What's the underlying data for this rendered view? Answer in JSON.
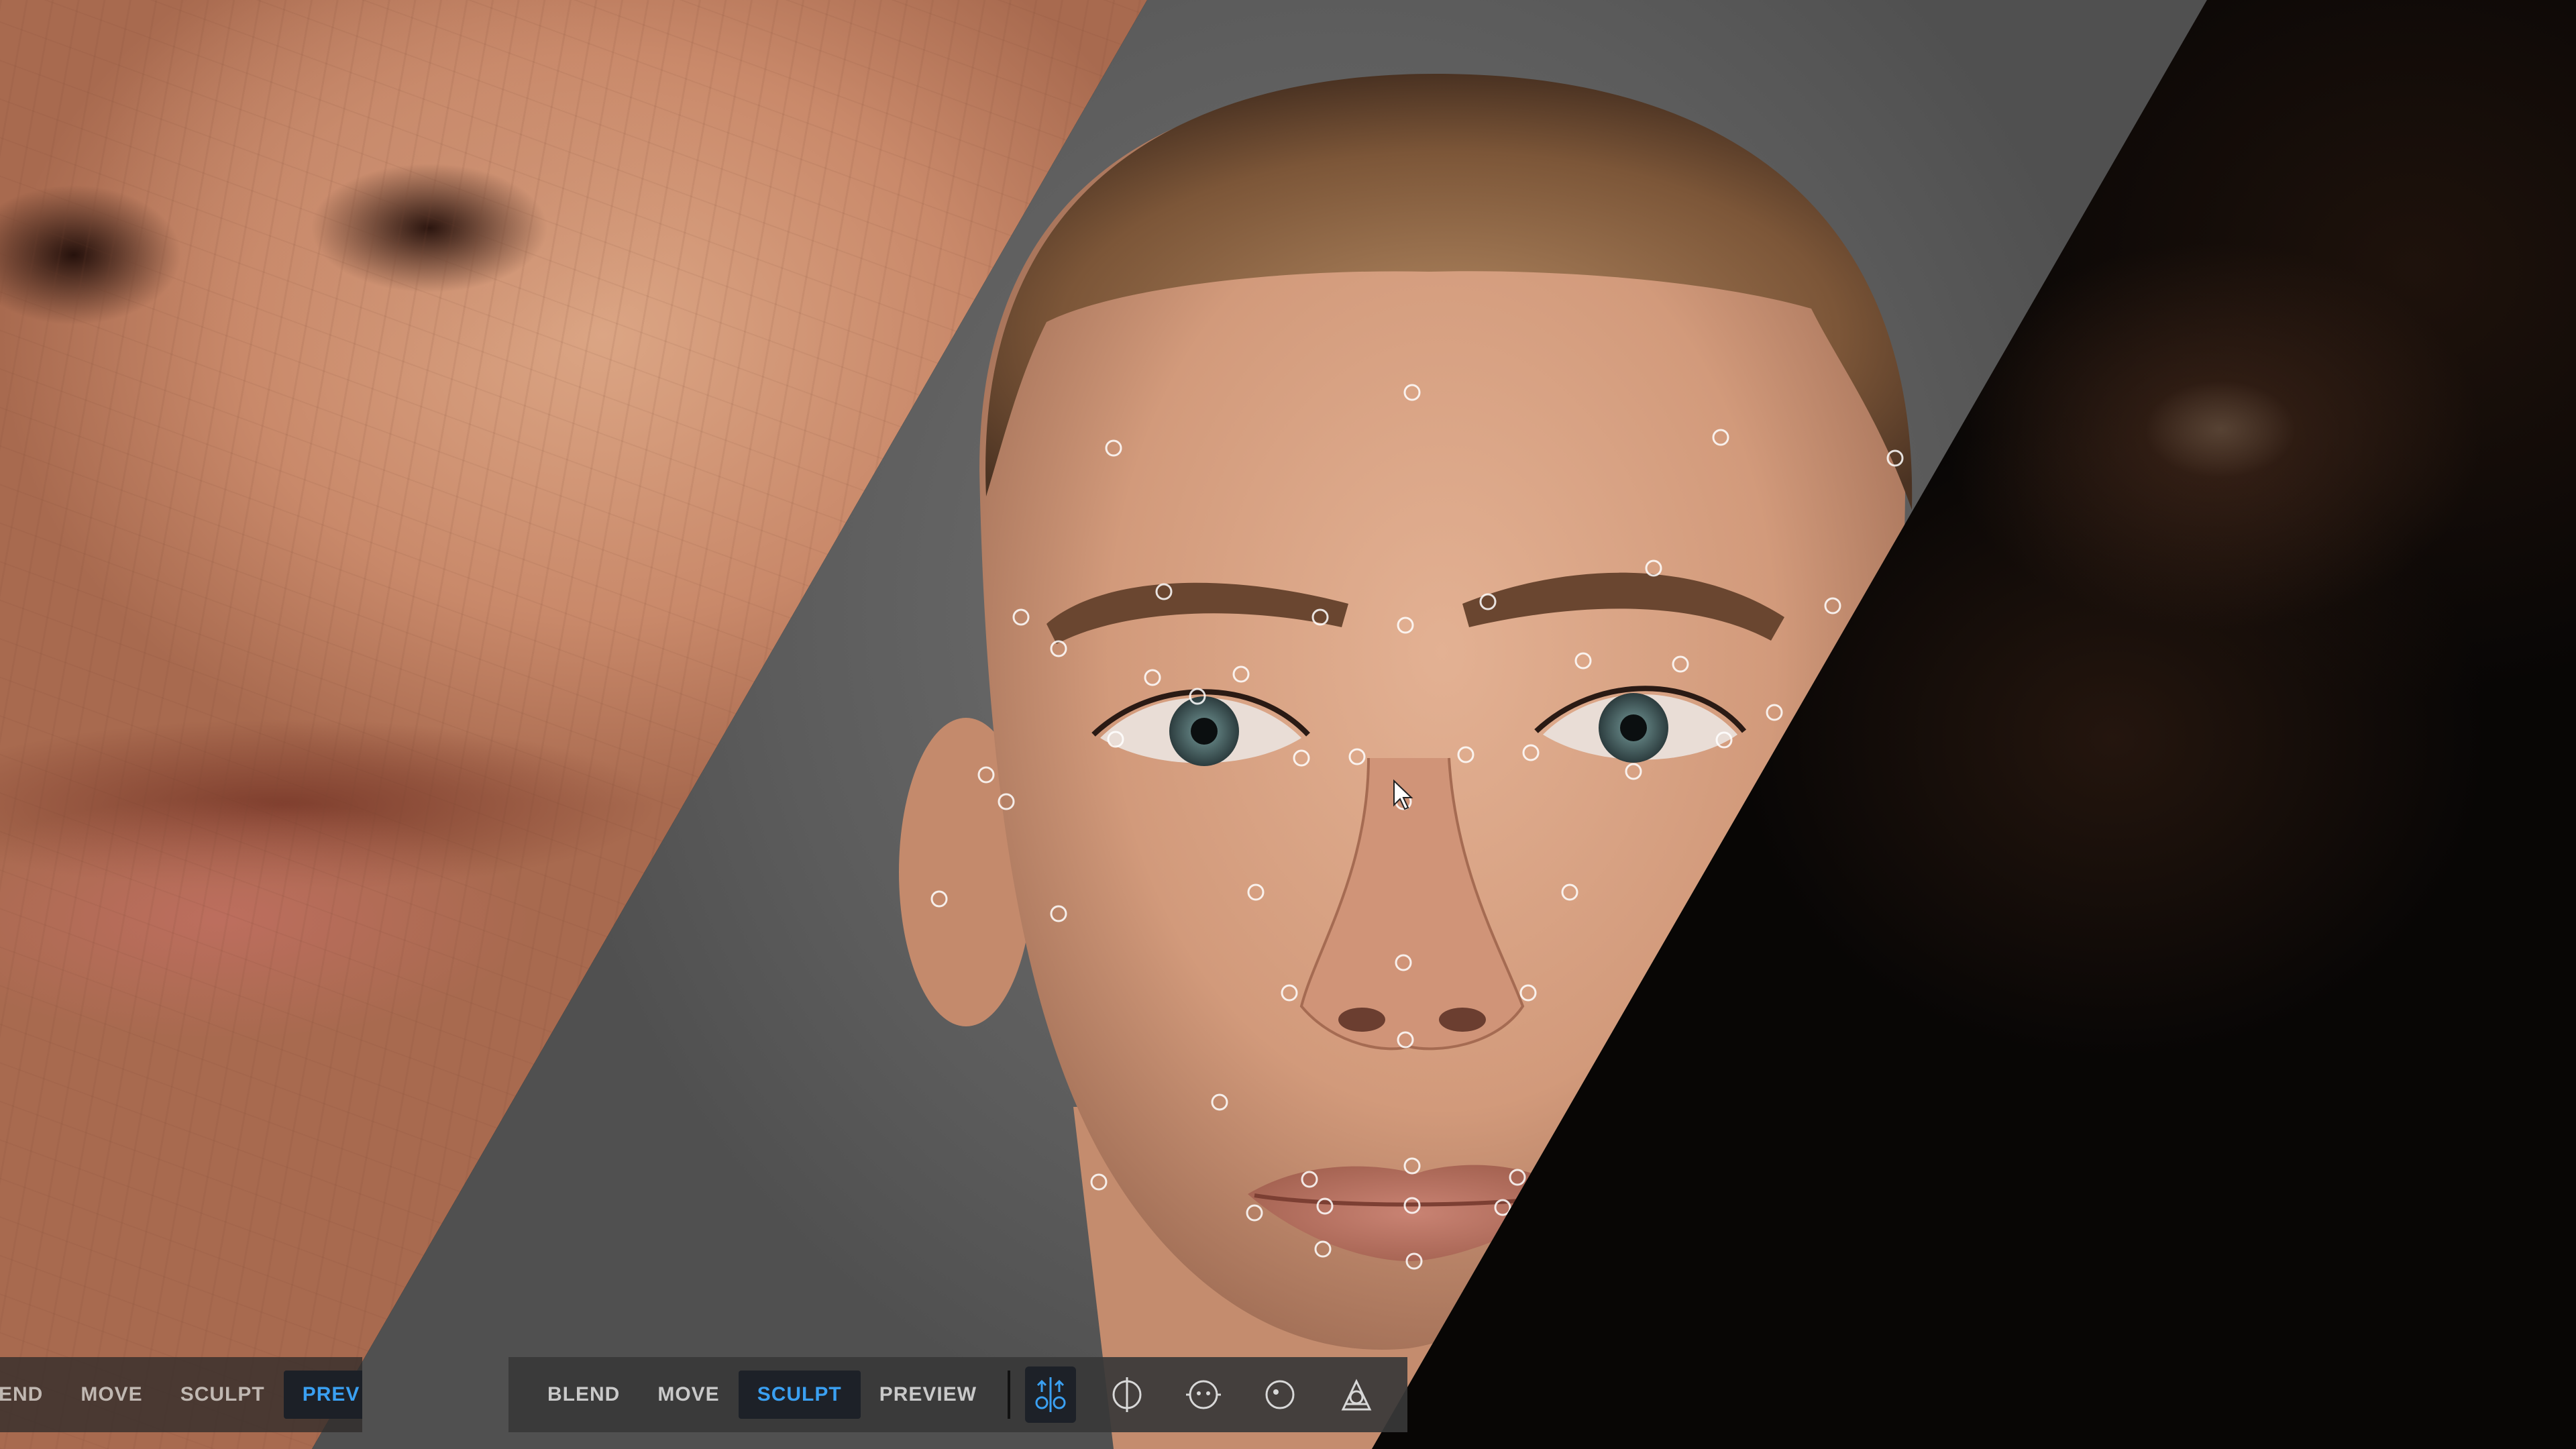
{
  "toolbar_main": {
    "modes": [
      {
        "label": "BLEND",
        "active": false
      },
      {
        "label": "MOVE",
        "active": false
      },
      {
        "label": "SCULPT",
        "active": true
      },
      {
        "label": "PREVIEW",
        "active": false
      }
    ],
    "tools": [
      {
        "icon": "symmetry-split-icon",
        "active": true
      },
      {
        "icon": "center-axis-icon",
        "active": false
      },
      {
        "icon": "face-ring-icon",
        "active": false
      },
      {
        "icon": "circle-dot-icon",
        "active": false
      },
      {
        "icon": "head-wireframe-icon",
        "active": false
      }
    ]
  },
  "toolbar_left": {
    "modes": [
      {
        "label": "END",
        "active": false
      },
      {
        "label": "MOVE",
        "active": false
      },
      {
        "label": "SCULPT",
        "active": false
      },
      {
        "label": "PREV",
        "active": true
      }
    ]
  },
  "colors": {
    "accent": "#3aa0f2",
    "toolbar_bg": "#383838",
    "active_bg": "#1d2128",
    "label": "#c9c9c9"
  }
}
